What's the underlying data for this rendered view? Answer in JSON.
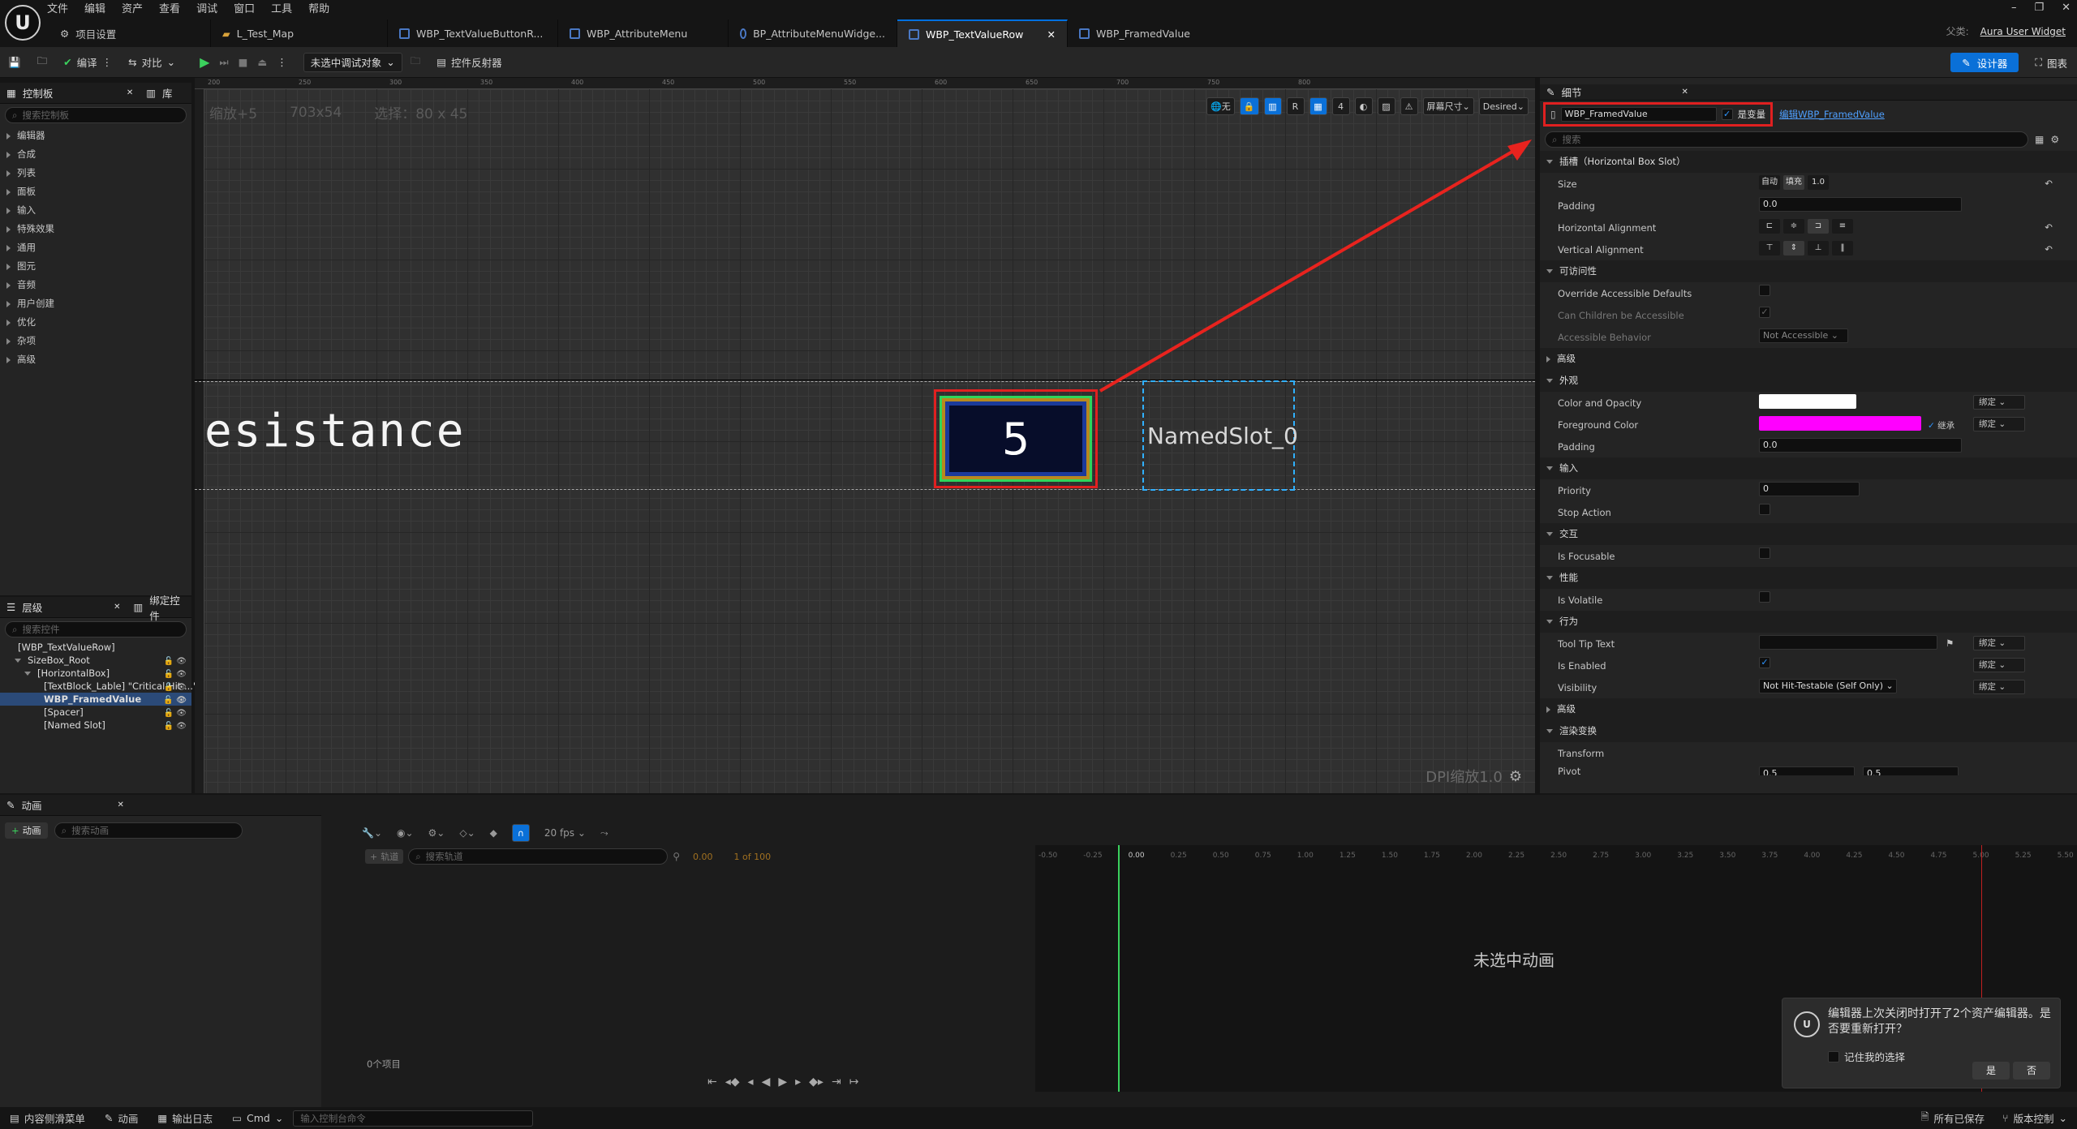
{
  "menu": [
    "文件",
    "编辑",
    "资产",
    "查看",
    "调试",
    "窗口",
    "工具",
    "帮助"
  ],
  "tabs": {
    "project_settings": "项目设置",
    "items": [
      {
        "label": "L_Test_Map",
        "active": false
      },
      {
        "label": "WBP_TextValueButtonR...",
        "active": false
      },
      {
        "label": "WBP_AttributeMenu",
        "active": false
      },
      {
        "label": "BP_AttributeMenuWidge...",
        "active": false
      },
      {
        "label": "WBP_TextValueRow",
        "active": true
      },
      {
        "label": "WBP_FramedValue",
        "active": false
      }
    ]
  },
  "parent": {
    "label": "父类:",
    "value": "Aura User Widget"
  },
  "toolbar": {
    "compile": "编译",
    "diff": "对比",
    "debug_dropdown": "未选中调试对象",
    "reflector": "控件反射器",
    "designer": "设计器",
    "graph": "图表"
  },
  "left": {
    "palette_tab": "控制板",
    "library_tab": "库",
    "palette_search": "搜索控制板",
    "categories": [
      "编辑器",
      "合成",
      "列表",
      "面板",
      "输入",
      "特殊效果",
      "通用",
      "图元",
      "音频",
      "用户创建",
      "优化",
      "杂项",
      "高级"
    ],
    "hier_tab": "层级",
    "bind_tab": "绑定控件",
    "hier_search": "搜索控件",
    "tree": [
      "[WBP_TextValueRow]",
      "SizeBox_Root",
      "[HorizontalBox]",
      "[TextBlock_Lable] \"Critical Hit ...\"",
      "WBP_FramedValue",
      "[Spacer]",
      "[Named Slot]"
    ]
  },
  "canvas": {
    "zoom": "缩放+5",
    "size": "703x54",
    "select": "选择：80 x 45",
    "text_widget": "esistance",
    "framed_value": "5",
    "named_slot": "NamedSlot_0",
    "dpi": "DPI缩放1.0",
    "screen_size": "屏幕尺寸",
    "desired": "Desired",
    "none": "无",
    "grid": "4",
    "rulers": [
      "200",
      "250",
      "300",
      "350",
      "400",
      "450",
      "500",
      "550",
      "600",
      "650",
      "700",
      "750",
      "800"
    ]
  },
  "details": {
    "tab": "细节",
    "name": "WBP_FramedValue",
    "is_variable": "是变量",
    "edit_link": "编辑WBP_FramedValue",
    "search": "搜索",
    "slot_section": "插槽（Horizontal Box Slot）",
    "size_label": "Size",
    "size_auto": "自动",
    "size_fill": "填充",
    "size_val": "1.0",
    "padding": "Padding",
    "padding_val": "0.0",
    "halign": "Horizontal Alignment",
    "valign": "Vertical Alignment",
    "access_section": "可访问性",
    "override": "Override Accessible Defaults",
    "can_children": "Can Children be Accessible",
    "behavior": "Accessible Behavior",
    "behavior_val": "Not Accessible",
    "advanced": "高级",
    "appearance": "外观",
    "color_opacity": "Color and Opacity",
    "fg_color": "Foreground Color",
    "inherit": "继承",
    "bind": "绑定",
    "input": "输入",
    "priority": "Priority",
    "priority_val": "0",
    "stop_action": "Stop Action",
    "interaction": "交互",
    "focusable": "Is Focusable",
    "performance": "性能",
    "volatile": "Is Volatile",
    "behavior_section": "行为",
    "tooltip": "Tool Tip Text",
    "enabled": "Is Enabled",
    "visibility": "Visibility",
    "visibility_val": "Not Hit-Testable (Self Only)",
    "render": "渲染变换",
    "transform": "Transform",
    "pivot": "Pivot",
    "pivot_x": "0.5",
    "pivot_y": "0.5",
    "colors": {
      "white": "#ffffff",
      "magenta": "#ff00ff"
    }
  },
  "anim": {
    "tab": "动画",
    "add": "动画",
    "search": "搜索动画",
    "track": "轨道",
    "track_search": "搜索轨道",
    "time": "0.00",
    "frames": "1 of 100",
    "fps": "20 fps",
    "none": "未选中动画",
    "items": "0个项目",
    "cursor": "0.00",
    "ticks": [
      "-0.50",
      "-0.25",
      "0.25",
      "0.50",
      "0.75",
      "1.00",
      "1.25",
      "1.50",
      "1.75",
      "2.00",
      "2.25",
      "2.50",
      "2.75",
      "3.00",
      "3.25",
      "3.50",
      "3.75",
      "4.00",
      "4.25",
      "4.50",
      "4.75",
      "5.00",
      "5.25",
      "5.50"
    ]
  },
  "toast": {
    "msg": "编辑器上次关闭时打开了2个资产编辑器。是否要重新打开？",
    "remember": "记住我的选择",
    "yes": "是",
    "no": "否"
  },
  "status": {
    "drawer": "内容侧滑菜单",
    "anim": "动画",
    "log": "输出日志",
    "cmd": "Cmd",
    "cmd_placeholder": "输入控制台命令",
    "saved": "所有已保存",
    "source": "版本控制"
  }
}
